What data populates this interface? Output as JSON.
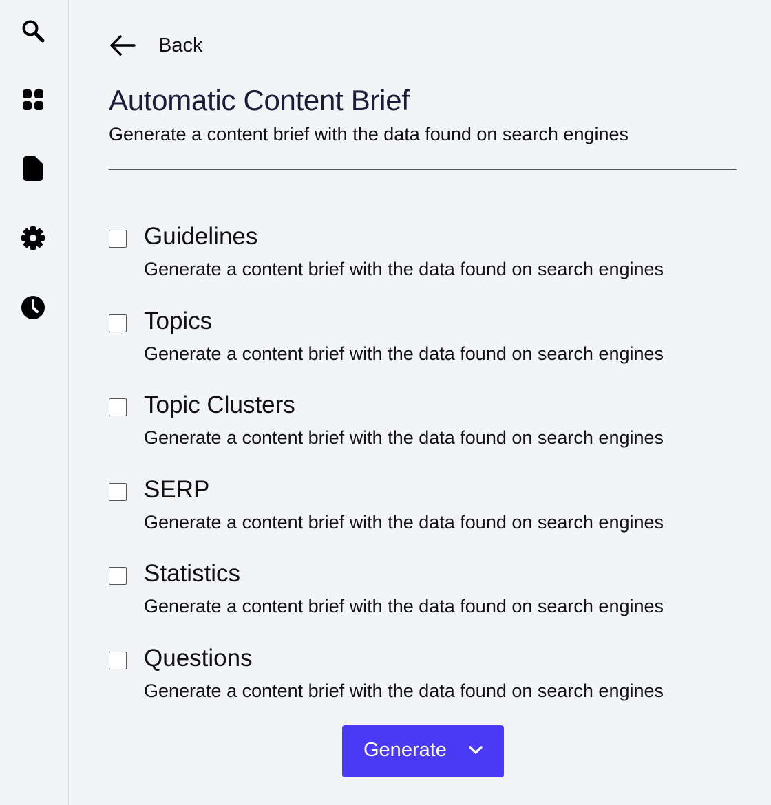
{
  "sidebar": {
    "items": [
      {
        "icon": "search-icon",
        "name": "search"
      },
      {
        "icon": "grid-icon",
        "name": "dashboard"
      },
      {
        "icon": "document-icon",
        "name": "documents"
      },
      {
        "icon": "gear-icon",
        "name": "settings"
      },
      {
        "icon": "clock-icon",
        "name": "history"
      }
    ]
  },
  "header": {
    "back_label": "Back",
    "back_icon": "arrow-left-icon",
    "title": "Automatic Content Brief",
    "subtitle": "Generate a content brief with the data found on search engines"
  },
  "options": [
    {
      "label": "Guidelines",
      "description": "Generate a content brief with the data found on search engines",
      "checked": false
    },
    {
      "label": "Topics",
      "description": "Generate a content brief with the data found on search engines",
      "checked": false
    },
    {
      "label": "Topic Clusters",
      "description": "Generate a content brief with the data found on search engines",
      "checked": false
    },
    {
      "label": "SERP",
      "description": "Generate a content brief with the data found on search engines",
      "checked": false
    },
    {
      "label": "Statistics",
      "description": "Generate a content brief with the data found on search engines",
      "checked": false
    },
    {
      "label": "Questions",
      "description": "Generate a content brief with the data found on search engines",
      "checked": false
    }
  ],
  "actions": {
    "generate_label": "Generate",
    "generate_icon": "chevron-down-icon"
  },
  "colors": {
    "background": "#f3f4f6",
    "accent": "#4a3af5",
    "title": "#1b1b3a",
    "text": "#111111"
  }
}
